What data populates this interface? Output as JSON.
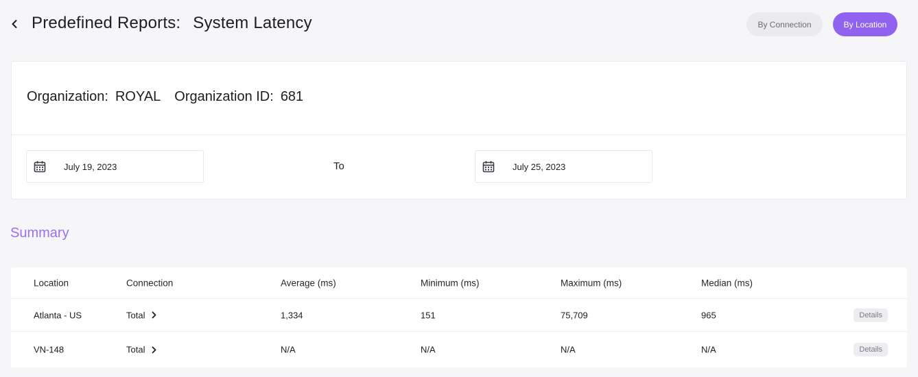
{
  "header": {
    "title_label": "Predefined Reports:",
    "title_value": "System Latency",
    "view_toggle": {
      "by_connection": "By Connection",
      "by_location": "By Location",
      "active": "by_location"
    }
  },
  "organization": {
    "name_label": "Organization:",
    "name_value": "ROYAL",
    "id_label": "Organization ID:",
    "id_value": "681"
  },
  "date_range": {
    "from": "July 19, 2023",
    "separator": "To",
    "to": "July 25, 2023"
  },
  "summary": {
    "title": "Summary",
    "columns": [
      "Location",
      "Connection",
      "Average (ms)",
      "Minimum (ms)",
      "Maximum (ms)",
      "Median (ms)"
    ],
    "rows": [
      {
        "location": "Atlanta - US",
        "connection": "Total",
        "average": "1,334",
        "minimum": "151",
        "maximum": "75,709",
        "median": "965",
        "action": "Details"
      },
      {
        "location": "VN-148",
        "connection": "Total",
        "average": "N/A",
        "minimum": "N/A",
        "maximum": "N/A",
        "median": "N/A",
        "action": "Details"
      }
    ]
  },
  "colors": {
    "accent": "#8f62f0",
    "summary_title": "#9a6ff2",
    "background": "#f6f6f8"
  },
  "icons": {
    "back": "chevron-left-icon",
    "calendar": "calendar-icon",
    "connection_expand": "chevron-right-icon"
  }
}
